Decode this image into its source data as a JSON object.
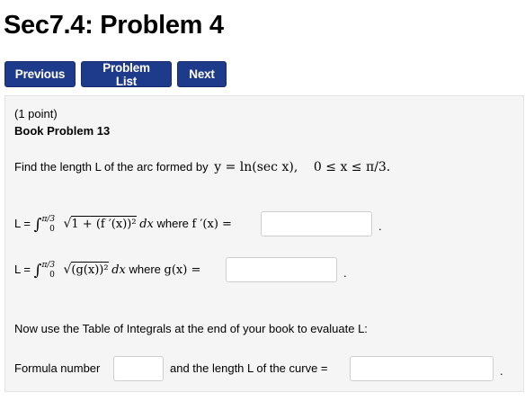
{
  "page": {
    "title": "Sec7.4: Problem 4"
  },
  "nav": {
    "previous_label": "Previous",
    "problem_list_label": "Problem List",
    "next_label": "Next"
  },
  "problem": {
    "points": "(1 point)",
    "book_problem": "Book Problem 13",
    "statement_prefix": "Find the length L of the arc formed by",
    "statement_function": "y = ln(sec x),",
    "statement_domain": "0 ≤ x ≤ π/3.",
    "line1": {
      "lead": "L =",
      "upper_limit": "π/3",
      "lower_limit": "0",
      "integrand": "1 + (f ′(x))²",
      "dx": "dx",
      "where_label": "where",
      "rhs": "f ′(x) =",
      "input_value": "",
      "period": "."
    },
    "line2": {
      "lead": "L =",
      "upper_limit": "π/3",
      "lower_limit": "0",
      "integrand": "(g(x))²",
      "dx": "dx",
      "where_label": "where",
      "rhs": "g(x) =",
      "input_value": "",
      "period": "."
    },
    "table_instruction": "Now use the Table of Integrals at the end of your book to evaluate L:",
    "formula_label": "Formula number",
    "formula_value": "",
    "length_label": "and the length L of the curve =",
    "length_value": "",
    "final_period": "."
  }
}
